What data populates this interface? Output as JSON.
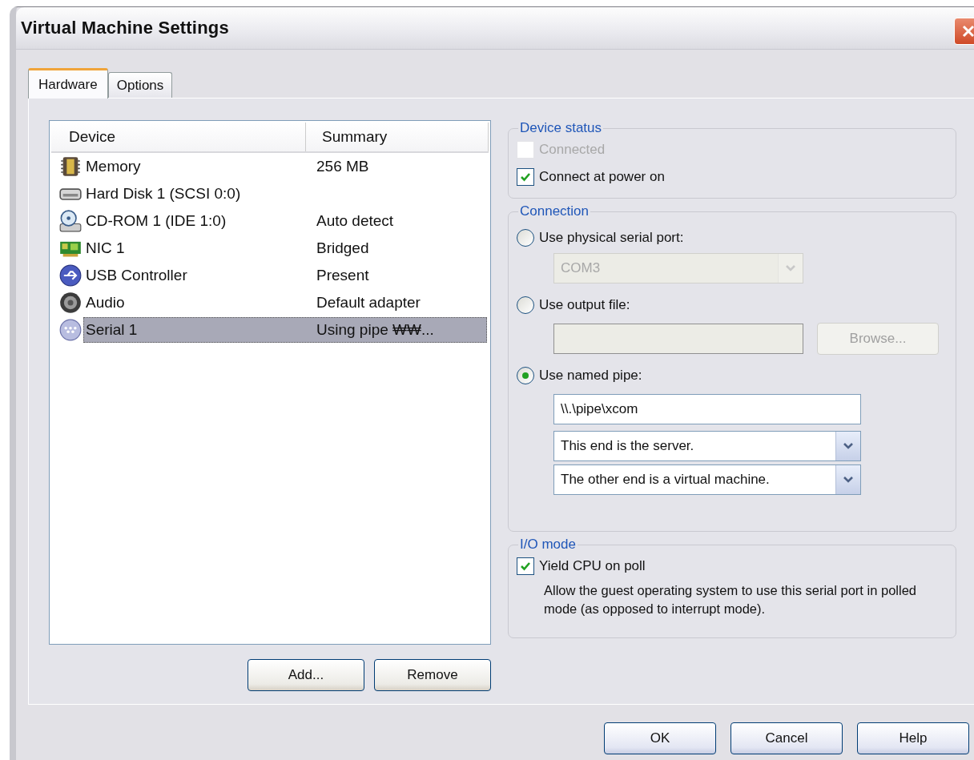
{
  "window": {
    "title": "Virtual Machine Settings"
  },
  "tabs": [
    {
      "label": "Hardware",
      "selected": true
    },
    {
      "label": "Options",
      "selected": false
    }
  ],
  "device_list": {
    "columns": [
      "Device",
      "Summary"
    ],
    "rows": [
      {
        "kind": "memory",
        "device": "Memory",
        "summary": "256 MB",
        "selected": false
      },
      {
        "kind": "hard-disk",
        "device": "Hard Disk 1 (SCSI 0:0)",
        "selected": false
      },
      {
        "kind": "cd-rom",
        "device": "CD-ROM 1 (IDE 1:0)",
        "summary": "Auto detect",
        "selected": false
      },
      {
        "kind": "nic",
        "device": "NIC 1",
        "summary": "Bridged",
        "selected": false
      },
      {
        "kind": "usb",
        "device": "USB Controller",
        "summary": "Present",
        "selected": false
      },
      {
        "kind": "audio",
        "device": "Audio",
        "summary": "Default adapter",
        "selected": false
      },
      {
        "kind": "serial",
        "device": "Serial 1",
        "summary": "Using pipe ₩₩...",
        "selected": true
      }
    ]
  },
  "list_buttons": [
    {
      "label": "Add..."
    },
    {
      "label": "Remove"
    }
  ],
  "device_status": {
    "title": "Device status",
    "options": [
      {
        "label": "Connected",
        "checked": false,
        "disabled": true
      },
      {
        "label": "Connect at power on",
        "checked": true,
        "disabled": false
      }
    ]
  },
  "connection": {
    "title": "Connection",
    "options": [
      {
        "kind": "port",
        "label": "Use physical serial port:",
        "selected": false,
        "dropdown": {
          "value": "COM3",
          "disabled": true
        }
      },
      {
        "kind": "file",
        "label": "Use output file:",
        "selected": false,
        "field": {
          "disabled": true
        },
        "button": {
          "label": "Browse...",
          "disabled": true
        }
      },
      {
        "kind": "pipe",
        "label": "Use named pipe:",
        "selected": true,
        "field": {
          "value": "\\\\.\\pipe\\xcom",
          "disabled": false
        },
        "dropdowns": [
          {
            "value": "This end is the server.",
            "disabled": false
          },
          {
            "value": "The other end is a virtual machine.",
            "disabled": false
          }
        ]
      }
    ]
  },
  "io_mode": {
    "title": "I/O mode",
    "option": {
      "label": "Yield CPU on poll",
      "checked": true,
      "disabled": false
    },
    "description": "Allow the guest operating system to use this serial port in polled mode (as opposed to interrupt mode)."
  },
  "buttons": [
    "OK",
    "Cancel",
    "Help"
  ]
}
